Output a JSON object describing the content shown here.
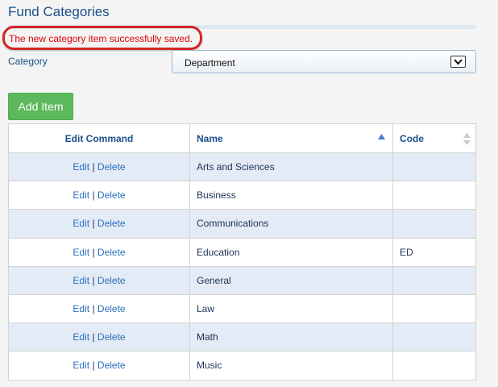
{
  "page": {
    "title": "Fund Categories",
    "message": "The new category item successfully saved."
  },
  "filter": {
    "label": "Category",
    "selected": "Department"
  },
  "toolbar": {
    "add_label": "Add Item"
  },
  "table": {
    "headers": {
      "command": "Edit Command",
      "name": "Name",
      "code": "Code"
    },
    "edit_label": "Edit",
    "separator": "|",
    "delete_label": "Delete",
    "rows": [
      {
        "name": "Arts and Sciences",
        "code": ""
      },
      {
        "name": "Business",
        "code": ""
      },
      {
        "name": "Communications",
        "code": ""
      },
      {
        "name": "Education",
        "code": "ED"
      },
      {
        "name": "General",
        "code": ""
      },
      {
        "name": "Law",
        "code": ""
      },
      {
        "name": "Math",
        "code": ""
      },
      {
        "name": "Music",
        "code": ""
      }
    ]
  },
  "colors": {
    "title": "#1a4f8a",
    "message": "#e00000",
    "highlight_oval": "#d42424",
    "add_button": "#5cb85c",
    "row_alt": "#e3ebf6",
    "link": "#2a6fbd"
  },
  "icons": {
    "dropdown": "chevron-down-icon",
    "name_sort": "sort-ascending-icon",
    "code_sort": "sort-both-icon"
  }
}
